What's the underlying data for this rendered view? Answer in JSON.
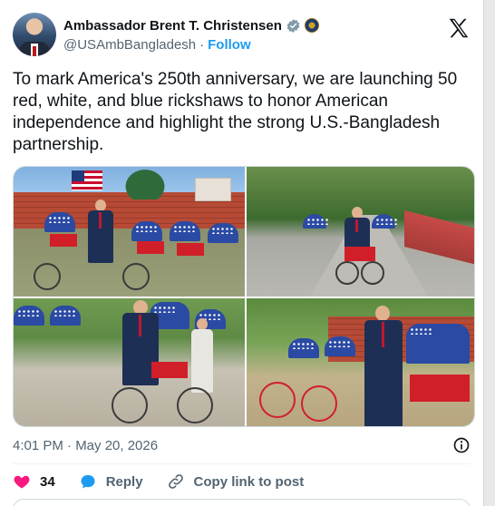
{
  "author": {
    "display_name": "Ambassador Brent T. Christensen",
    "handle": "@USAmbBangladesh",
    "separator": "·",
    "follow_label": "Follow"
  },
  "tweet": {
    "text": "To mark America's 250th anniversary, we are launching 50 red, white, and blue rickshaws to honor American independence and highlight the strong U.S.-Bangladesh partnership.",
    "timestamp": "4:01 PM · May 20, 2026"
  },
  "actions": {
    "like_count": "34",
    "reply_label": "Reply",
    "copy_label": "Copy link to post"
  },
  "icons": {
    "verified": "verified-badge-icon",
    "x_logo": "x-logo-icon",
    "info": "info-icon",
    "heart": "heart-icon",
    "reply": "reply-bubble-icon",
    "link": "link-icon"
  },
  "colors": {
    "accent": "#1d9bf0",
    "heart": "#f91880",
    "text": "#0f1419",
    "muted": "#536471"
  }
}
